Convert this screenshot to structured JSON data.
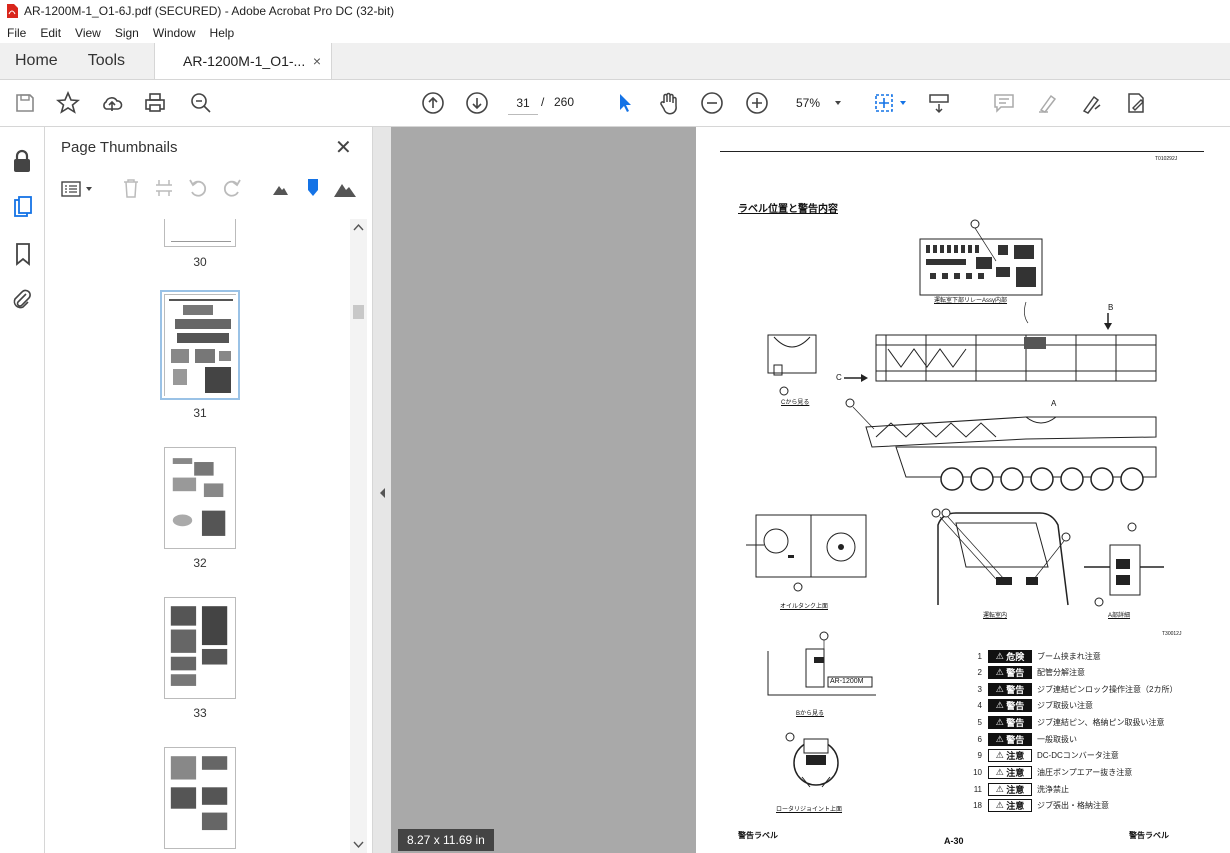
{
  "window": {
    "title": "AR-1200M-1_O1-6J.pdf (SECURED) - Adobe Acrobat Pro DC (32-bit)"
  },
  "menu": [
    "File",
    "Edit",
    "View",
    "Sign",
    "Window",
    "Help"
  ],
  "tabs": {
    "home": "Home",
    "tools": "Tools",
    "document": "AR-1200M-1_O1-...",
    "close": "×"
  },
  "nav": {
    "current_page": "31",
    "separator": "/",
    "total_pages": "260",
    "zoom": "57%"
  },
  "panel": {
    "title": "Page Thumbnails",
    "thumbnails": [
      {
        "label": "30"
      },
      {
        "label": "31",
        "selected": true
      },
      {
        "label": "32"
      },
      {
        "label": "33"
      },
      {
        "label": ""
      }
    ]
  },
  "status": {
    "page_size": "8.27 x 11.69 in"
  },
  "page": {
    "doc_code_top": "T010292J",
    "heading": "ラベル位置と警告内容",
    "relay_caption": "運転室下部リレーAssy内部",
    "view_c_caption": "Cから見る",
    "oil_tank_caption": "オイルタンク上面",
    "cab_caption": "運転室内",
    "a_section_caption": "A部詳細",
    "view_b_caption": "Bから見る",
    "model_plate": "AR-1200M",
    "rotary_caption": "ロータリジョイント上面",
    "doc_code_mid": "T30012J",
    "letters": {
      "a": "A",
      "b": "B",
      "c": "C"
    },
    "labels": [
      {
        "num": "1",
        "badge": "危険",
        "style": "black",
        "text": "ブーム挟まれ注意"
      },
      {
        "num": "2",
        "badge": "警告",
        "style": "black",
        "text": "配管分解注意"
      },
      {
        "num": "3",
        "badge": "警告",
        "style": "black",
        "text": "ジブ連結ピンロック操作注意（2カ所）"
      },
      {
        "num": "4",
        "badge": "警告",
        "style": "black",
        "text": "ジブ取扱い注意"
      },
      {
        "num": "5",
        "badge": "警告",
        "style": "black",
        "text": "ジブ連結ピン、格納ピン取扱い注意"
      },
      {
        "num": "6",
        "badge": "警告",
        "style": "black",
        "text": "一般取扱い"
      },
      {
        "num": "9",
        "badge": "注意",
        "style": "outline",
        "text": "DC-DCコンバータ注意"
      },
      {
        "num": "10",
        "badge": "注意",
        "style": "outline",
        "text": "油圧ポンプエアー抜き注意"
      },
      {
        "num": "11",
        "badge": "注意",
        "style": "outline",
        "text": "洗浄禁止"
      },
      {
        "num": "18",
        "badge": "注意",
        "style": "outline",
        "text": "ジブ張出・格納注意"
      }
    ],
    "footer_left": "警告ラベル",
    "footer_center": "A-30",
    "footer_right": "警告ラベル"
  }
}
